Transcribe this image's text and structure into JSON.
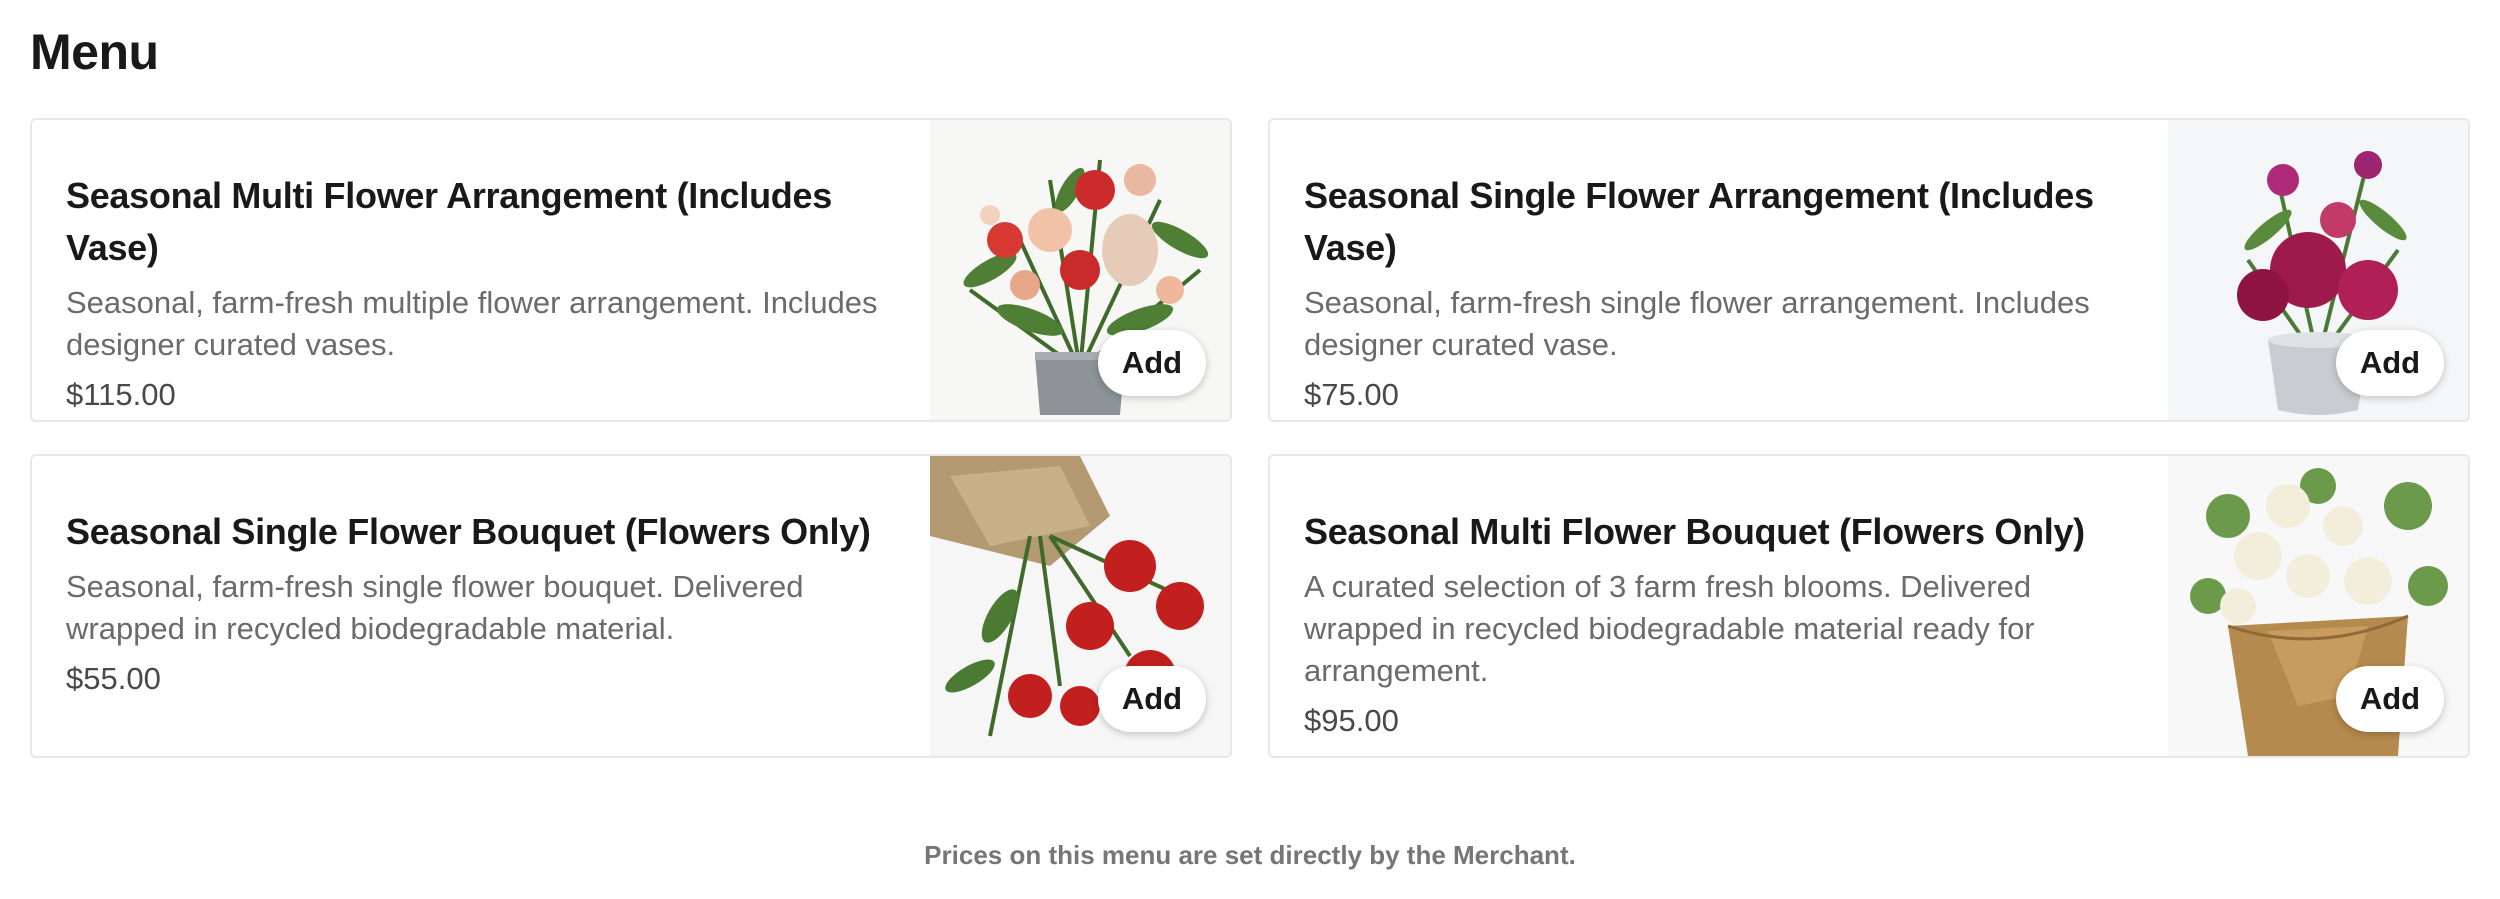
{
  "page": {
    "title": "Menu"
  },
  "items": [
    {
      "title": "Seasonal Multi Flower Arrangement (Includes Vase)",
      "description": "Seasonal, farm-fresh multiple flower arrangement. Includes designer curated vases.",
      "price": "$115.00",
      "add_label": "Add",
      "image_alt": "multi-flower-arrangement-in-vase"
    },
    {
      "title": "Seasonal Single Flower Arrangement (Includes Vase)",
      "description": "Seasonal, farm-fresh single flower arrangement. Includes designer curated vase.",
      "price": "$75.00",
      "add_label": "Add",
      "image_alt": "single-flower-arrangement-in-vase"
    },
    {
      "title": "Seasonal Single Flower Bouquet (Flowers Only)",
      "description": "Seasonal, farm-fresh single flower bouquet. Delivered wrapped in recycled biodegradable material.",
      "price": "$55.00",
      "add_label": "Add",
      "image_alt": "single-flower-bouquet-wrapped"
    },
    {
      "title": "Seasonal Multi Flower Bouquet (Flowers Only)",
      "description": "A curated selection of 3 farm fresh blooms. Delivered wrapped in recycled biodegradable material ready for arrangement.",
      "price": "$95.00",
      "add_label": "Add",
      "image_alt": "multi-flower-bouquet-wrapped"
    }
  ],
  "footer": {
    "note": "Prices on this menu are set directly by the Merchant."
  },
  "colors": {
    "text_primary": "#191919",
    "text_secondary": "#6b6b6b",
    "card_border": "#e8e8e8"
  }
}
